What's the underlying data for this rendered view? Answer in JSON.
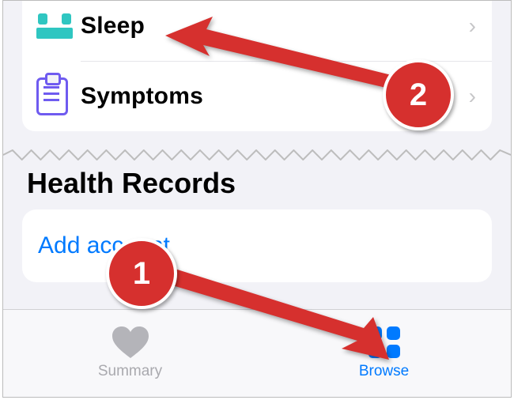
{
  "list": {
    "items": [
      {
        "label": "Sleep",
        "icon": "sleep-icon"
      },
      {
        "label": "Symptoms",
        "icon": "symptoms-icon"
      }
    ]
  },
  "section": {
    "title": "Health Records"
  },
  "records": {
    "add_label": "Add account"
  },
  "tabs": {
    "summary": {
      "label": "Summary",
      "active": false
    },
    "browse": {
      "label": "Browse",
      "active": true
    }
  },
  "annotations": {
    "step1": "1",
    "step2": "2"
  }
}
